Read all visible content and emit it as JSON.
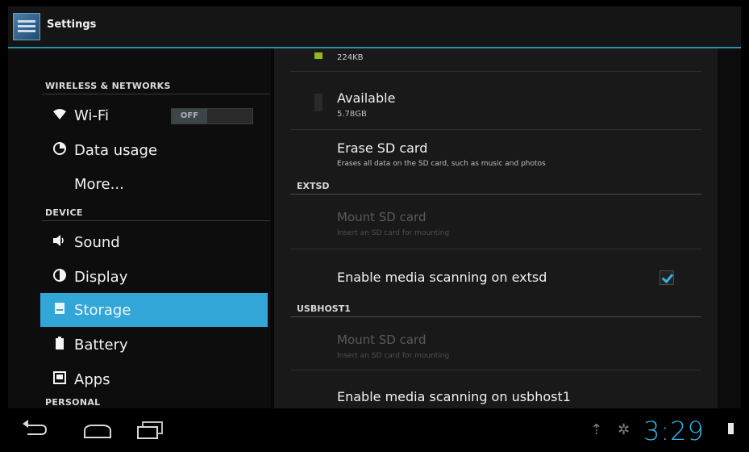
{
  "app": {
    "title": "Settings",
    "icon": "settings-app-icon"
  },
  "sidebar": {
    "sections": [
      {
        "header": "WIRELESS & NETWORKS"
      },
      {
        "header": "DEVICE"
      },
      {
        "header": "PERSONAL"
      }
    ],
    "items": [
      {
        "label": "Wi-Fi",
        "icon": "wifi-icon",
        "toggle": "OFF"
      },
      {
        "label": "Data usage",
        "icon": "data-usage-icon"
      },
      {
        "label": "More...",
        "icon": ""
      },
      {
        "label": "Sound",
        "icon": "speaker-icon"
      },
      {
        "label": "Display",
        "icon": "display-icon"
      },
      {
        "label": "Storage",
        "icon": "storage-icon",
        "selected": true
      },
      {
        "label": "Battery",
        "icon": "battery-icon"
      },
      {
        "label": "Apps",
        "icon": "apps-icon"
      }
    ]
  },
  "storage": {
    "top_partial_value": "224KB",
    "available": {
      "title": "Available",
      "value": "5.78GB"
    },
    "erase": {
      "title": "Erase SD card",
      "summary": "Erases all data on the SD card, such as music and photos"
    },
    "extsd": {
      "header": "EXTSD",
      "mount": {
        "title": "Mount SD card",
        "summary": "Insert an SD card for mounting"
      },
      "scan": {
        "title": "Enable media scanning on extsd",
        "checked": true
      }
    },
    "usbhost1": {
      "header": "USBHOST1",
      "mount": {
        "title": "Mount SD card",
        "summary": "Insert an SD card for mounting"
      },
      "scan": {
        "title": "Enable media scanning on usbhost1"
      }
    }
  },
  "system_bar": {
    "time": "3:29"
  },
  "colors": {
    "accent": "#33a6d8",
    "clock": "#35b2e8",
    "background": "#0b0b0b"
  }
}
